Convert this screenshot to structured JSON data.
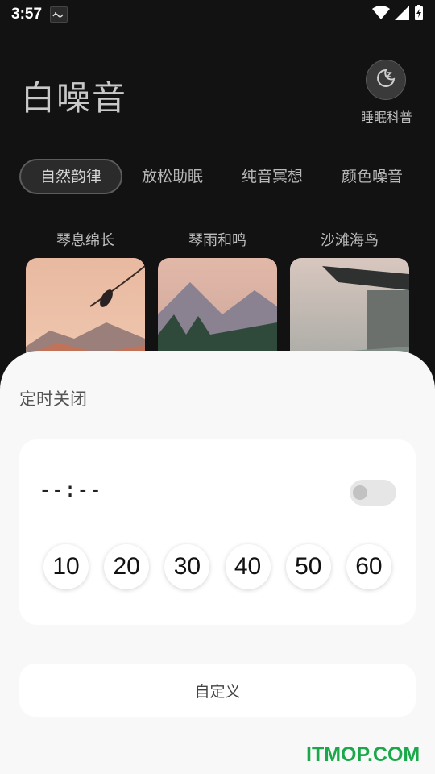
{
  "status_bar": {
    "time": "3:57",
    "icons": [
      "notification-icon",
      "wifi-icon",
      "signal-icon",
      "battery-charging-icon"
    ]
  },
  "header": {
    "title": "白噪音",
    "sleep_button_icon": "moon-zz-icon",
    "sleep_label": "睡眠科普"
  },
  "tabs": [
    {
      "label": "自然韵律",
      "active": true
    },
    {
      "label": "放松助眠",
      "active": false
    },
    {
      "label": "纯音冥想",
      "active": false
    },
    {
      "label": "颜色噪音",
      "active": false
    }
  ],
  "sounds": [
    {
      "title": "琴息绵长"
    },
    {
      "title": "琴雨和鸣"
    },
    {
      "title": "沙滩海鸟"
    }
  ],
  "timer_sheet": {
    "title": "定时关闭",
    "current_value": "--:--",
    "toggle_on": false,
    "presets": [
      "10",
      "20",
      "30",
      "40",
      "50",
      "60"
    ],
    "custom_label": "自定义"
  },
  "watermark": "ITMOP.COM",
  "colors": {
    "background": "#121212",
    "sheet": "#f8f8f8",
    "watermark": "#1aa84a"
  }
}
